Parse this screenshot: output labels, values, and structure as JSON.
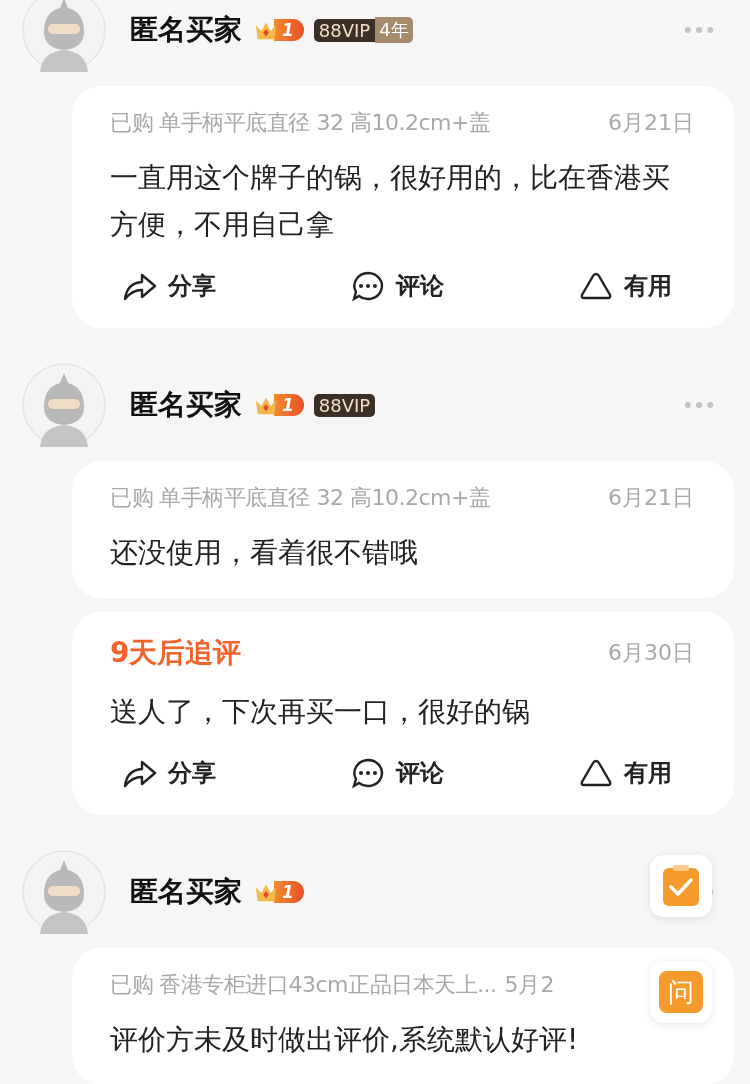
{
  "reviews": [
    {
      "user": {
        "name": "匿名买家",
        "level": "1",
        "vip": "88VIP",
        "vip_years": "4年"
      },
      "parts": [
        {
          "kind": "review",
          "purchase": "已购 单手柄平底直径 32 高10.2cm+盖",
          "date": "6月21日",
          "text": "一直用这个牌子的锅，很好用的，比在香港买方便，不用自己拿"
        }
      ],
      "actions": [
        {
          "kind": "share",
          "label": "分享"
        },
        {
          "kind": "comment",
          "label": "评论"
        },
        {
          "kind": "useful",
          "label": "有用"
        }
      ]
    },
    {
      "user": {
        "name": "匿名买家",
        "level": "1",
        "vip": "88VIP"
      },
      "parts": [
        {
          "kind": "review",
          "purchase": "已购 单手柄平底直径 32 高10.2cm+盖",
          "date": "6月21日",
          "text": "还没使用，看着很不错哦"
        },
        {
          "kind": "followup",
          "label": "9天后追评",
          "date": "6月30日",
          "text": "送人了，下次再买一口，很好的锅"
        }
      ],
      "actions": [
        {
          "kind": "share",
          "label": "分享"
        },
        {
          "kind": "comment",
          "label": "评论"
        },
        {
          "kind": "useful",
          "label": "有用"
        }
      ]
    },
    {
      "user": {
        "name": "匿名买家",
        "level": "1"
      },
      "parts": [
        {
          "kind": "review",
          "purchase": "已购 香港专柜进口43cm正品日本天上...",
          "date": "5月2",
          "text": "评价方未及时做出评价,系统默认好评!"
        }
      ]
    }
  ],
  "floating_buttons": [
    {
      "kind": "checklist"
    },
    {
      "kind": "ask",
      "label": "问"
    }
  ]
}
